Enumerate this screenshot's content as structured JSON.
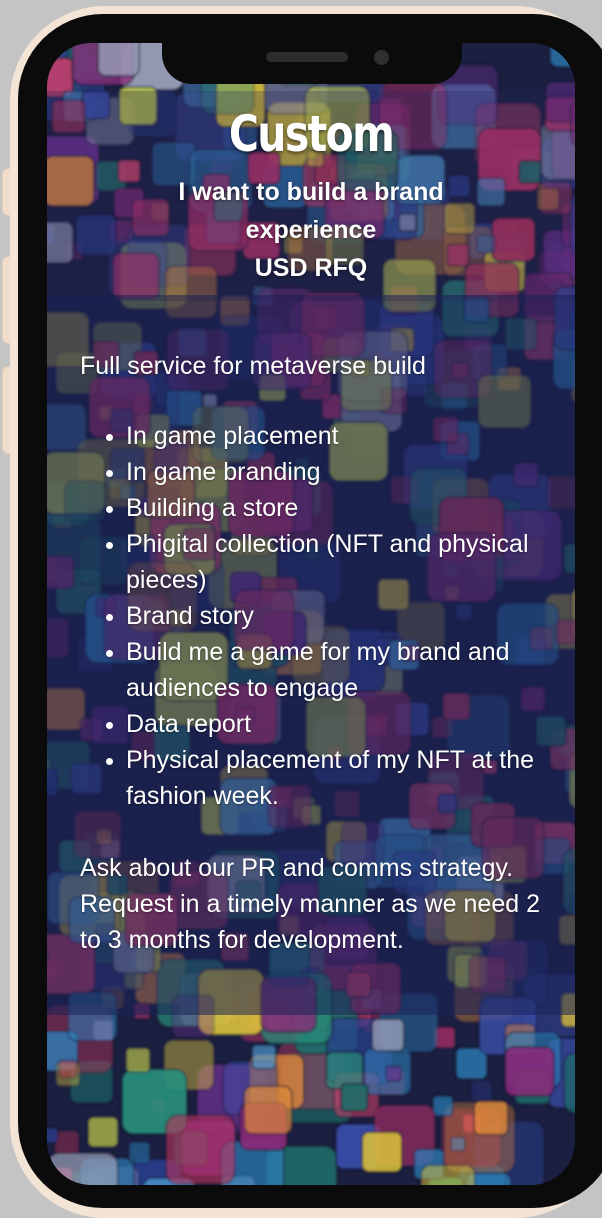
{
  "header": {
    "title": "Custom",
    "subtitle_line1": "I want to build a brand",
    "subtitle_line2": "experience",
    "price": "USD RFQ"
  },
  "content": {
    "intro": "Full service for metaverse build",
    "features": [
      "In game placement",
      "In game branding",
      "Building a store",
      "Phigital collection (NFT and physical pieces)",
      "Brand story",
      "Build me a game for my brand and audiences to engage",
      "Data report",
      "Physical placement of my NFT at the fashion week."
    ],
    "footer_note": "Ask about our PR and comms strategy. Request in a timely manner as we need 2 to 3 months for development."
  }
}
